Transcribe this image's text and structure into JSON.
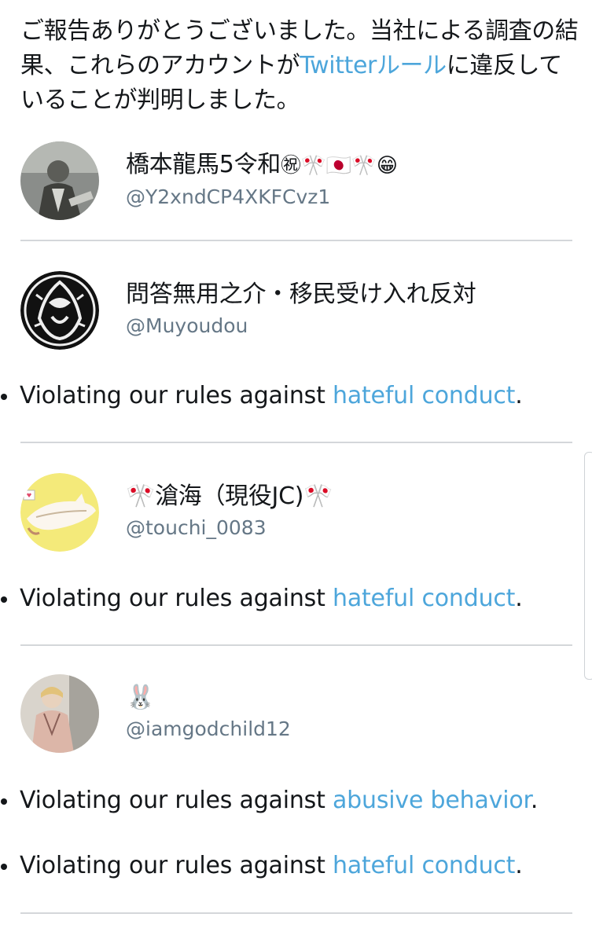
{
  "intro": {
    "text_before": "ご報告ありがとうございました。当社による調査の結果、これらのアカウントが",
    "link_text": "Twitterルール",
    "text_after": "に違反していることが判明しました。"
  },
  "rule_prefix": "Violating our rules against ",
  "accounts": [
    {
      "display_name": "橋本龍馬5令和",
      "name_emoji": "㊗🎌🇯🇵🎌😁",
      "handle": "@Y2xndCP4XKFCvz1",
      "violations": []
    },
    {
      "display_name": "問答無用之介・移民受け入れ反対",
      "handle": "@Muyoudou",
      "violations": [
        {
          "link": "hateful conduct",
          "end": "."
        }
      ]
    },
    {
      "display_name": "🎌滄海（現役JC)🎌",
      "handle": "@touchi_0083",
      "violations": [
        {
          "link": "hateful conduct",
          "end": "."
        }
      ]
    },
    {
      "display_name": "🐰",
      "handle": "@iamgodchild12",
      "violations": [
        {
          "link": "abusive behavior",
          "end": "."
        },
        {
          "link": "hateful conduct",
          "end": "."
        }
      ]
    }
  ],
  "colors": {
    "link": "#4da6db",
    "text": "#14171a",
    "handle": "#657786",
    "divider": "#d4d7da"
  }
}
